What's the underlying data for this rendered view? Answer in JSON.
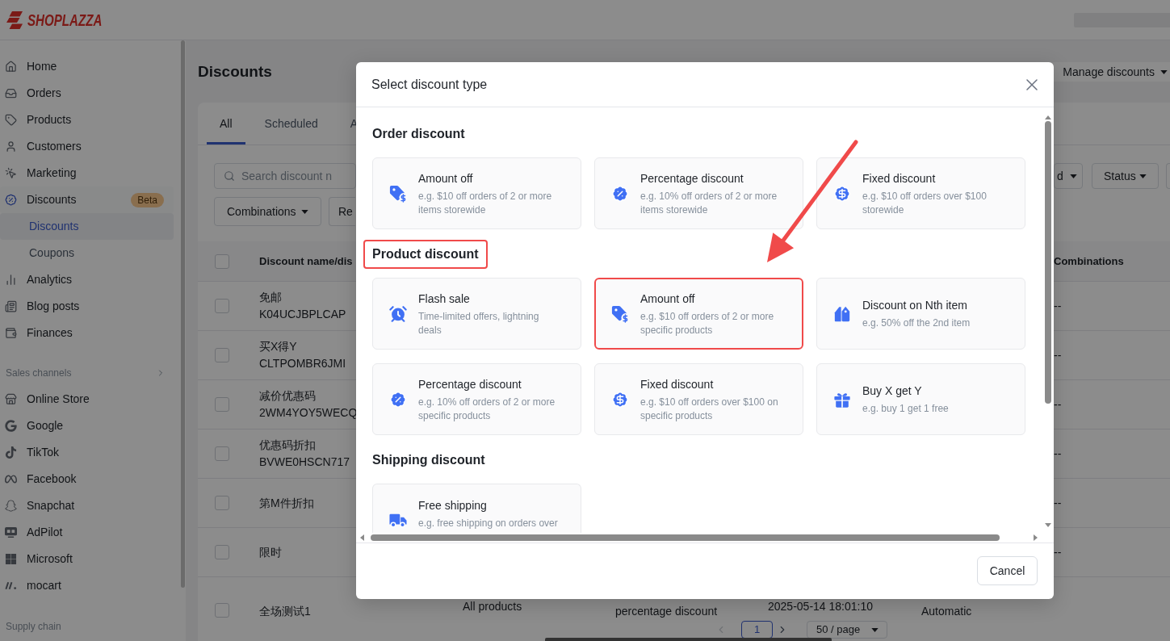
{
  "top_bar": {
    "logo": "SHOPLAZZA"
  },
  "sidebar": {
    "items": [
      {
        "label": "Home",
        "selected": false
      },
      {
        "label": "Orders",
        "selected": false
      },
      {
        "label": "Products",
        "selected": false
      },
      {
        "label": "Customers",
        "selected": false
      },
      {
        "label": "Marketing",
        "selected": false
      },
      {
        "label": "Discounts",
        "selected": true,
        "badge": "Beta",
        "children": [
          {
            "label": "Discounts",
            "selected": true
          },
          {
            "label": "Coupons",
            "selected": false
          }
        ]
      },
      {
        "label": "Analytics",
        "selected": false
      },
      {
        "label": "Blog posts",
        "selected": false
      },
      {
        "label": "Finances",
        "selected": false
      }
    ],
    "sections": [
      {
        "label": "Sales channels",
        "items": [
          {
            "label": "Online Store",
            "selected": false
          },
          {
            "label": "Google",
            "selected": false
          },
          {
            "label": "TikTok",
            "selected": false
          },
          {
            "label": "Facebook",
            "selected": false
          },
          {
            "label": "Snapchat",
            "selected": false
          },
          {
            "label": "AdPilot",
            "selected": false
          },
          {
            "label": "Microsoft",
            "selected": false
          },
          {
            "label": "mocart",
            "selected": false
          }
        ]
      },
      {
        "label": "Supply chain"
      }
    ]
  },
  "page": {
    "title": "Discounts",
    "manage_button": "Manage discounts",
    "tabs": [
      {
        "label": "All",
        "selected": true
      },
      {
        "label": "Scheduled",
        "selected": false
      },
      {
        "label": "A",
        "selected": false
      }
    ],
    "search": {
      "placeholder": "Search discount n"
    },
    "filters": [
      {
        "label": "Combinations",
        "kind": "dropdown"
      },
      {
        "label": "Re",
        "kind": "button"
      }
    ],
    "right_filters": [
      {
        "label": "d",
        "kind": "dropdown"
      },
      {
        "label": "Status",
        "kind": "dropdown"
      }
    ],
    "table": {
      "checked": false,
      "columns": [
        {
          "label": "Discount name/dis"
        },
        {
          "label": "Combinations"
        }
      ],
      "rows": [
        {
          "checked": false,
          "name": "免邮",
          "code": "K04UCJBPLCAP",
          "combinations": "--"
        },
        {
          "checked": false,
          "name": "买X得Y",
          "code": "CLTPOMBR6JMI",
          "combinations": "--"
        },
        {
          "checked": false,
          "name": "减价优惠码",
          "code": "2WM4YOY5WECQ",
          "combinations": "--"
        },
        {
          "checked": false,
          "name": "优惠码折扣",
          "code": "BVWE0HSCN717",
          "combinations": "--"
        },
        {
          "checked": false,
          "name": "第M件折扣",
          "combinations": "--"
        },
        {
          "checked": false,
          "name": "限时",
          "combinations": "--"
        },
        {
          "checked": false,
          "name": "全场测试1",
          "column_3": "All products",
          "column_4": "percentage discount",
          "column_5": "2025-05-14 18:01:10",
          "column_6": "Automatic"
        }
      ]
    },
    "pagination": {
      "pages": [
        {
          "label": "1",
          "selected": true
        }
      ],
      "page_size": "50 / page"
    }
  },
  "dialog": {
    "title": "Select discount type",
    "sections": [
      {
        "heading": "Order discount",
        "highlighted": false,
        "options": [
          {
            "title": "Amount off",
            "description": "e.g. $10 off orders of 2 or more items storewide",
            "highlighted": false
          },
          {
            "title": "Percentage discount",
            "description": "e.g. 10% off orders of 2 or more items storewide",
            "highlighted": false
          },
          {
            "title": "Fixed discount",
            "description": "e.g. $10 off orders over $100 storewide",
            "highlighted": false
          }
        ]
      },
      {
        "heading": "Product discount",
        "highlighted": true,
        "options": [
          {
            "title": "Flash sale",
            "description": "Time-limited offers, lightning deals",
            "highlighted": false
          },
          {
            "title": "Amount off",
            "description": "e.g. $10 off orders of 2 or more specific products",
            "highlighted": true
          },
          {
            "title": "Discount on Nth item",
            "description": "e.g. 50% off the 2nd item",
            "highlighted": false
          },
          {
            "title": "Percentage discount",
            "description": "e.g. 10% off orders of 2 or more specific products",
            "highlighted": false
          },
          {
            "title": "Fixed discount",
            "description": "e.g. $10 off orders over $100 on specific products",
            "highlighted": false
          },
          {
            "title": "Buy X get Y",
            "description": "e.g. buy 1 get 1 free",
            "highlighted": false
          }
        ]
      },
      {
        "heading": "Shipping discount",
        "highlighted": false,
        "options": [
          {
            "title": "Free shipping",
            "description": "e.g. free shipping on orders over",
            "highlighted": false
          }
        ]
      }
    ],
    "cancel_button": "Cancel"
  }
}
